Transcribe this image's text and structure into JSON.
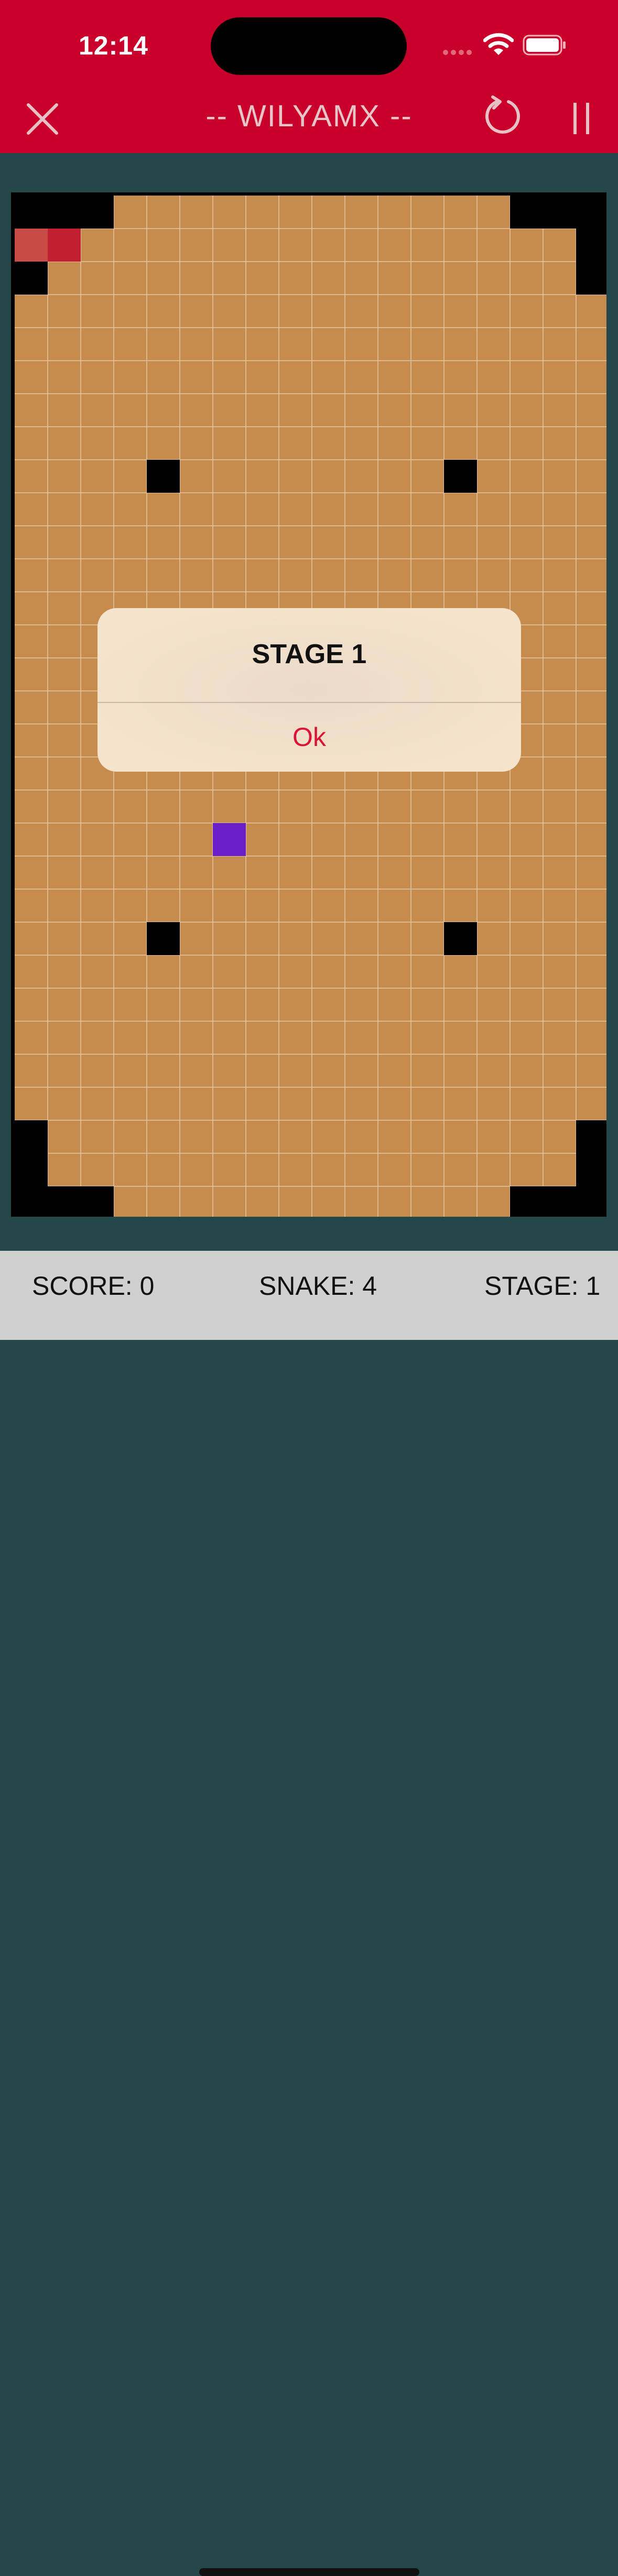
{
  "status_bar": {
    "time": "12:14"
  },
  "nav": {
    "title": "-- WILYAMX --"
  },
  "icons": {
    "close": "close-icon",
    "restart": "restart-icon",
    "pause": "pause-icon",
    "wifi": "wifi-icon",
    "battery": "battery-icon"
  },
  "board": {
    "cols": 18,
    "rows": 31,
    "colors": {
      "floor": "#c68c4e",
      "grid": "#e4c7a0",
      "wall": "#000000",
      "snake_head": "#c94b45",
      "snake_body": "#c02030",
      "food": "#6a1ec8"
    },
    "walls": [
      [
        0,
        0
      ],
      [
        1,
        0
      ],
      [
        2,
        0
      ],
      [
        15,
        0
      ],
      [
        16,
        0
      ],
      [
        17,
        0
      ],
      [
        17,
        1
      ],
      [
        17,
        2
      ],
      [
        0,
        2
      ],
      [
        4,
        8
      ],
      [
        13,
        8
      ],
      [
        4,
        22
      ],
      [
        13,
        22
      ],
      [
        0,
        28
      ],
      [
        0,
        29
      ],
      [
        0,
        30
      ],
      [
        1,
        30
      ],
      [
        2,
        30
      ],
      [
        17,
        28
      ],
      [
        17,
        29
      ],
      [
        17,
        30
      ],
      [
        16,
        30
      ],
      [
        15,
        30
      ]
    ],
    "snake": [
      [
        0,
        1
      ],
      [
        1,
        1
      ]
    ],
    "food": [
      6,
      19
    ]
  },
  "dialog": {
    "title": "STAGE 1",
    "ok_label": "Ok"
  },
  "scorebar": {
    "score": "SCORE: 0",
    "snake": "SNAKE: 4",
    "stage": "STAGE: 1"
  }
}
